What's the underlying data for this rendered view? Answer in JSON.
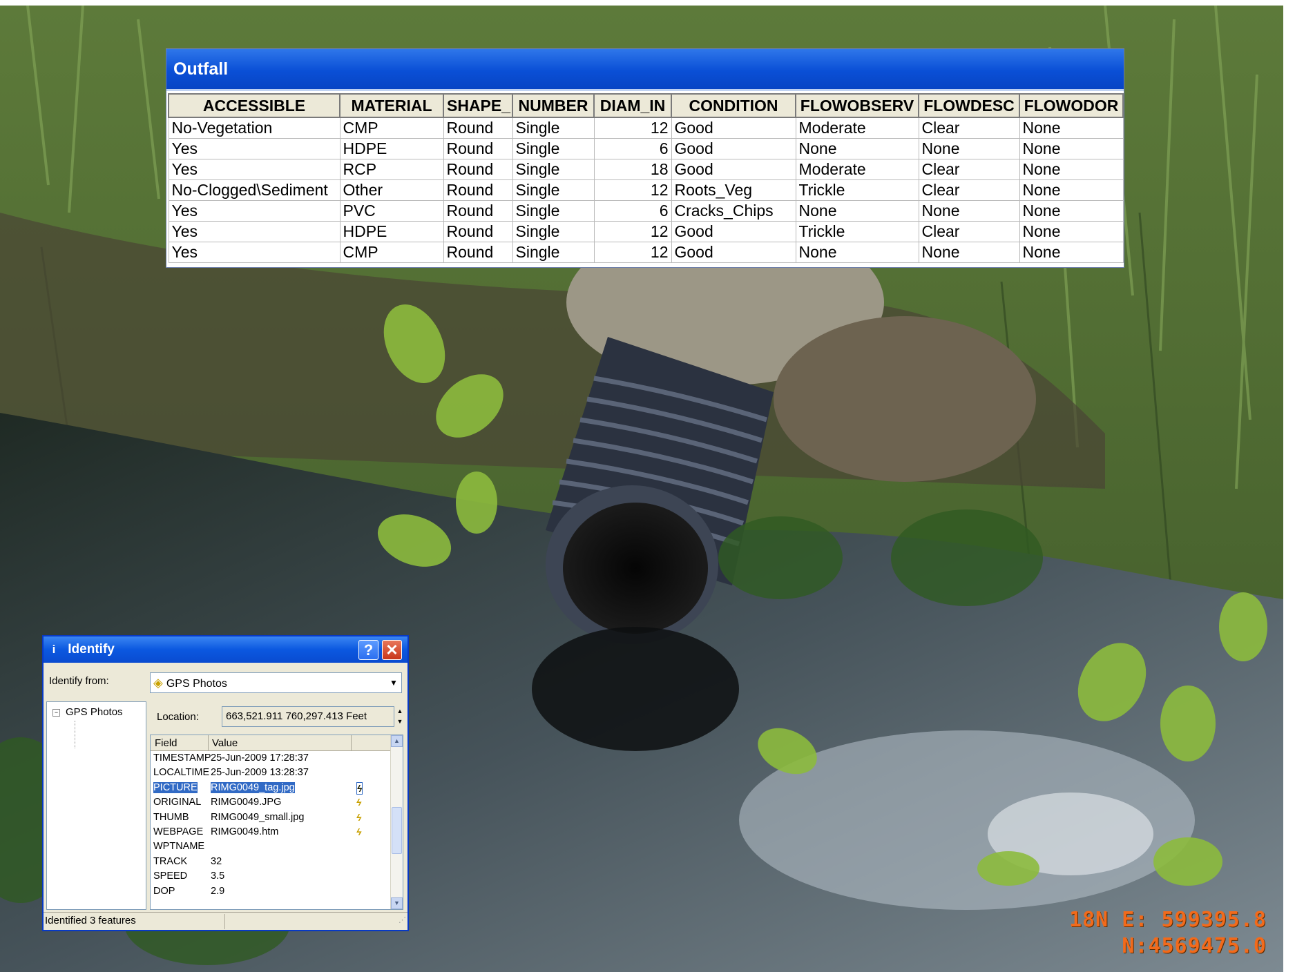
{
  "outfall": {
    "title": "Outfall",
    "columns": [
      "ACCESSIBLE",
      "MATERIAL",
      "SHAPE_",
      "NUMBER",
      "DIAM_IN",
      "CONDITION",
      "FLOWOBSERV",
      "FLOWDESC",
      "FLOWODOR"
    ],
    "rows": [
      [
        "No-Vegetation",
        "CMP",
        "Round",
        "Single",
        "12",
        "Good",
        "Moderate",
        "Clear",
        "None"
      ],
      [
        "Yes",
        "HDPE",
        "Round",
        "Single",
        "6",
        "Good",
        "None",
        "None",
        "None"
      ],
      [
        "Yes",
        "RCP",
        "Round",
        "Single",
        "18",
        "Good",
        "Moderate",
        "Clear",
        "None"
      ],
      [
        "No-Clogged\\Sediment",
        "Other",
        "Round",
        "Single",
        "12",
        "Roots_Veg",
        "Trickle",
        "Clear",
        "None"
      ],
      [
        "Yes",
        "PVC",
        "Round",
        "Single",
        "6",
        "Cracks_Chips",
        "None",
        "None",
        "None"
      ],
      [
        "Yes",
        "HDPE",
        "Round",
        "Single",
        "12",
        "Good",
        "Trickle",
        "Clear",
        "None"
      ],
      [
        "Yes",
        "CMP",
        "Round",
        "Single",
        "12",
        "Good",
        "None",
        "None",
        "None"
      ]
    ]
  },
  "identify": {
    "title": "Identify",
    "identify_from_label": "Identify from:",
    "identify_from_value": "GPS Photos",
    "tree_root": "GPS Photos",
    "location_label": "Location:",
    "location_value": "663,521.911  760,297.413 Feet",
    "grid_headers": {
      "field": "Field",
      "value": "Value"
    },
    "grid_rows": [
      {
        "field": "TIMESTAMP",
        "value": "25-Jun-2009 17:28:37"
      },
      {
        "field": "LOCALTIME",
        "value": "25-Jun-2009 13:28:37"
      },
      {
        "field": "PICTURE",
        "value": "RIMG0049_tag.jpg"
      },
      {
        "field": "ORIGINAL",
        "value": "RIMG0049.JPG"
      },
      {
        "field": "THUMB",
        "value": "RIMG0049_small.jpg"
      },
      {
        "field": "WEBPAGE",
        "value": "RIMG0049.htm"
      },
      {
        "field": "WPTNAME",
        "value": ""
      },
      {
        "field": "TRACK",
        "value": "32"
      },
      {
        "field": "SPEED",
        "value": "3.5"
      },
      {
        "field": "DOP",
        "value": "2.9"
      }
    ],
    "selected_row": 2,
    "hyperlink_rows": [
      2,
      3,
      4,
      5
    ],
    "status": "Identified 3 features",
    "help_button": "?",
    "close_button": "✕"
  },
  "photo_stamp": {
    "line1": "18N E: 599395.8",
    "line2": "N:4569475.0"
  },
  "colors": {
    "titlebar_blue": "#0a4fd6",
    "selection_blue": "#316ac5",
    "stamp_orange": "#f26a1b"
  },
  "icons": {
    "layer": "diamond-layer-icon",
    "info": "info-icon",
    "hyperlink": "lightning-hyperlink-icon"
  }
}
